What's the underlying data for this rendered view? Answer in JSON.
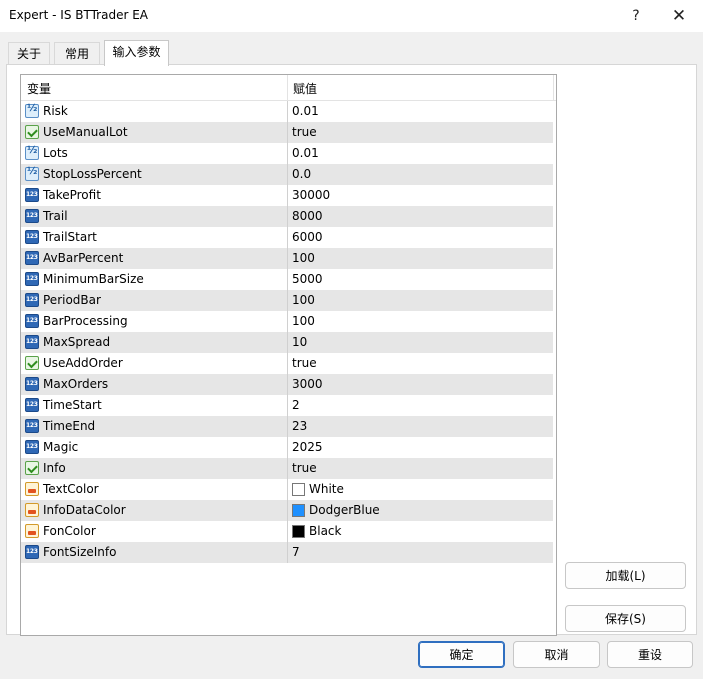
{
  "window": {
    "title": "Expert - IS BTTrader EA",
    "help_glyph": "?",
    "close_glyph": "✕"
  },
  "tabs": [
    {
      "label": "关于"
    },
    {
      "label": "常用"
    },
    {
      "label": "输入参数"
    }
  ],
  "grid": {
    "header": {
      "name": "变量",
      "value": "赋值"
    },
    "rows": [
      {
        "name": "Risk",
        "value": "0.01",
        "type": "double"
      },
      {
        "name": "UseManualLot",
        "value": "true",
        "type": "bool"
      },
      {
        "name": "Lots",
        "value": "0.01",
        "type": "double"
      },
      {
        "name": "StopLossPercent",
        "value": "0.0",
        "type": "double"
      },
      {
        "name": "TakeProfit",
        "value": "30000",
        "type": "int"
      },
      {
        "name": "Trail",
        "value": "8000",
        "type": "int"
      },
      {
        "name": "TrailStart",
        "value": "6000",
        "type": "int"
      },
      {
        "name": "AvBarPercent",
        "value": "100",
        "type": "int"
      },
      {
        "name": "MinimumBarSize",
        "value": "5000",
        "type": "int"
      },
      {
        "name": "PeriodBar",
        "value": "100",
        "type": "int"
      },
      {
        "name": "BarProcessing",
        "value": "100",
        "type": "int"
      },
      {
        "name": "MaxSpread",
        "value": "10",
        "type": "int"
      },
      {
        "name": "UseAddOrder",
        "value": "true",
        "type": "bool"
      },
      {
        "name": "MaxOrders",
        "value": "3000",
        "type": "int"
      },
      {
        "name": "TimeStart",
        "value": "2",
        "type": "int"
      },
      {
        "name": "TimeEnd",
        "value": "23",
        "type": "int"
      },
      {
        "name": "Magic",
        "value": "2025",
        "type": "int"
      },
      {
        "name": "Info",
        "value": "true",
        "type": "bool"
      },
      {
        "name": "TextColor",
        "value": "White",
        "type": "color",
        "swatch": "#ffffff"
      },
      {
        "name": "InfoDataColor",
        "value": "DodgerBlue",
        "type": "color",
        "swatch": "#1e90ff"
      },
      {
        "name": "FonColor",
        "value": "Black",
        "type": "color",
        "swatch": "#000000"
      },
      {
        "name": "FontSizeInfo",
        "value": "7",
        "type": "int"
      }
    ]
  },
  "side_buttons": {
    "load": "加载(L)",
    "save": "保存(S)"
  },
  "footer_buttons": {
    "ok": "确定",
    "cancel": "取消",
    "reset": "重设"
  }
}
